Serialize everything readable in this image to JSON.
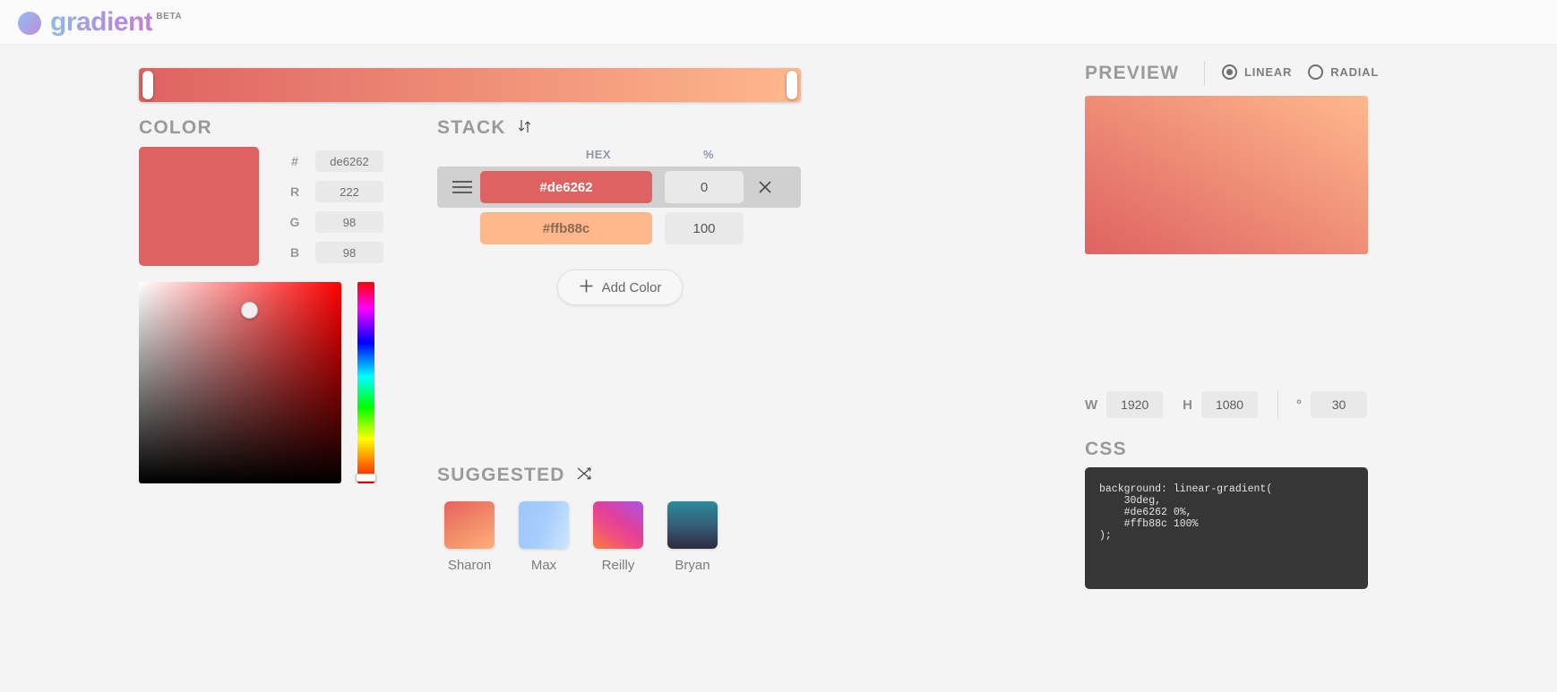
{
  "app": {
    "logo_text": "gradient",
    "beta_label": "BETA"
  },
  "gradient_bar": {
    "css_gradient": "linear-gradient(90deg, #de6262 0%, #ffb88c 100%)",
    "stops": [
      {
        "hex": "#de6262",
        "position": 0
      },
      {
        "hex": "#ffb88c",
        "position": 100
      }
    ]
  },
  "color_panel": {
    "heading": "COLOR",
    "swatch_hex": "#de6262",
    "fields": [
      {
        "label": "#",
        "value": "de6262",
        "name": "hex"
      },
      {
        "label": "R",
        "value": "222",
        "name": "red"
      },
      {
        "label": "G",
        "value": "98",
        "name": "green"
      },
      {
        "label": "B",
        "value": "98",
        "name": "blue"
      }
    ]
  },
  "stack": {
    "heading": "STACK",
    "sort_icon": "sort-updown-icon",
    "columns": {
      "hex": "HEX",
      "percent": "%"
    },
    "rows": [
      {
        "hex": "#de6262",
        "percent": "0",
        "active": true,
        "text_color": "#ffffff",
        "drag_icon": "drag-handle-icon",
        "delete_icon": "close-icon"
      },
      {
        "hex": "#ffb88c",
        "percent": "100",
        "active": false,
        "text_color": "#8a6a52"
      }
    ],
    "add_button": {
      "label": "Add Color",
      "icon": "plus-icon"
    }
  },
  "suggested": {
    "heading": "SUGGESTED",
    "shuffle_icon": "shuffle-icon",
    "items": [
      {
        "name": "Sharon",
        "gradient": "linear-gradient(150deg, #e8615e 0%, #f08a67 50%, #ffb07d 100%)"
      },
      {
        "name": "Max",
        "gradient": "linear-gradient(110deg, #9dc6fb 0%, #a7cdfc 50%, #cfe6fd 100%)"
      },
      {
        "name": "Reilly",
        "gradient": "linear-gradient(35deg, #f77f3a 0%, #ef4a86 38%, #e0409a 58%, #a855e8 100%)"
      },
      {
        "name": "Bryan",
        "gradient": "linear-gradient(180deg, #2b8b9c 0%, #355a73 55%, #2d2a3e 100%)"
      }
    ]
  },
  "preview": {
    "heading": "PREVIEW",
    "modes": [
      {
        "label": "LINEAR",
        "selected": true
      },
      {
        "label": "RADIAL",
        "selected": false
      }
    ],
    "gradient": "linear-gradient(30deg, #de6262 0%, #ffb88c 100%)"
  },
  "dimensions": {
    "width_label": "W",
    "width_value": "1920",
    "height_label": "H",
    "height_value": "1080",
    "angle_label": "°",
    "angle_value": "30"
  },
  "css_output": {
    "heading": "CSS",
    "code": "background: linear-gradient(\n    30deg,\n    #de6262 0%,\n    #ffb88c 100%\n);"
  }
}
